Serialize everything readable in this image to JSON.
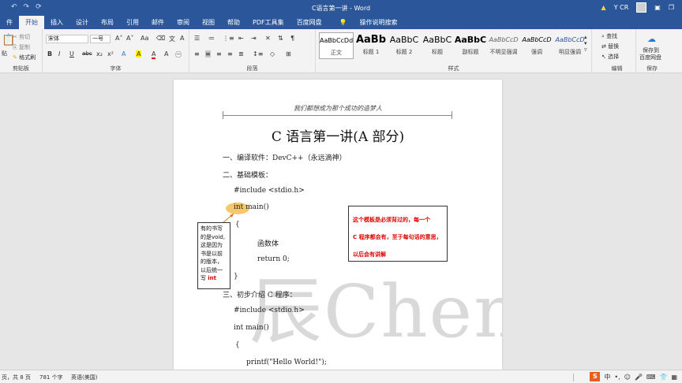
{
  "window": {
    "title": "C语言第一讲 - Word",
    "user": "Y CR"
  },
  "quick_access": [
    "↶",
    "↷",
    "⟳"
  ],
  "tabs": [
    "件",
    "开始",
    "插入",
    "设计",
    "布局",
    "引用",
    "邮件",
    "审阅",
    "视图",
    "帮助",
    "PDF工具集",
    "百度网盘"
  ],
  "active_tab": "开始",
  "tell_me": "操作说明搜索",
  "ribbon": {
    "clipboard": {
      "paste": "贴",
      "cut": "剪切",
      "copy": "复制",
      "format_painter": "格式刷",
      "label": "剪贴板"
    },
    "font": {
      "name": "宋体",
      "size": "一号",
      "label": "字体",
      "buttons": [
        "B",
        "I",
        "U",
        "abc",
        "x₂",
        "x²",
        "A",
        "A",
        "A",
        "Aa",
        "A",
        "A"
      ]
    },
    "paragraph": {
      "label": "段落"
    },
    "styles": {
      "label": "样式",
      "items": [
        {
          "sample": "AaBbCcDd",
          "name": "正文"
        },
        {
          "sample": "AaBb",
          "name": "标题 1"
        },
        {
          "sample": "AaBbC",
          "name": "标题 2"
        },
        {
          "sample": "AaBbC",
          "name": "标题"
        },
        {
          "sample": "AaBbC",
          "name": "副标题"
        },
        {
          "sample": "AaBbCcD",
          "name": "不明显强调"
        },
        {
          "sample": "AaBbCcD",
          "name": "强调"
        },
        {
          "sample": "AaBbCcD",
          "name": "明显强调"
        }
      ]
    },
    "editing": {
      "find": "查找",
      "replace": "替换",
      "select": "选择",
      "label": "编辑"
    },
    "save": {
      "btn1": "保存到",
      "btn2": "百度网盘",
      "label": "保存"
    }
  },
  "document": {
    "header_text": "我们都想成为那个成功的造梦人",
    "title": "C 语言第一讲(A 部分)",
    "lines": [
      "一、编译软件：DevC++（永远滴神）",
      "二、基础模板：",
      "#include <stdio.h>",
      "int main()",
      "{",
      "函数体",
      "return 0;",
      "}",
      "三、初步介绍 C 程序：",
      "#include <stdio.h>",
      "int main()",
      "{",
      "printf(\"Hello World!\");"
    ],
    "callout_text": "有的书写的是void,这是因为书是以前的版本，以后统一写",
    "callout_red": "int",
    "note_lines": [
      "这个模板是必须背过的，每一个",
      "C 程序都会有，至于每句话的意思，",
      "以后会有讲解"
    ],
    "watermark": "辰Chen"
  },
  "status": {
    "page": "页，共 8 页",
    "words": "781 个字",
    "lang": "英语(美国)",
    "ime": "中"
  }
}
